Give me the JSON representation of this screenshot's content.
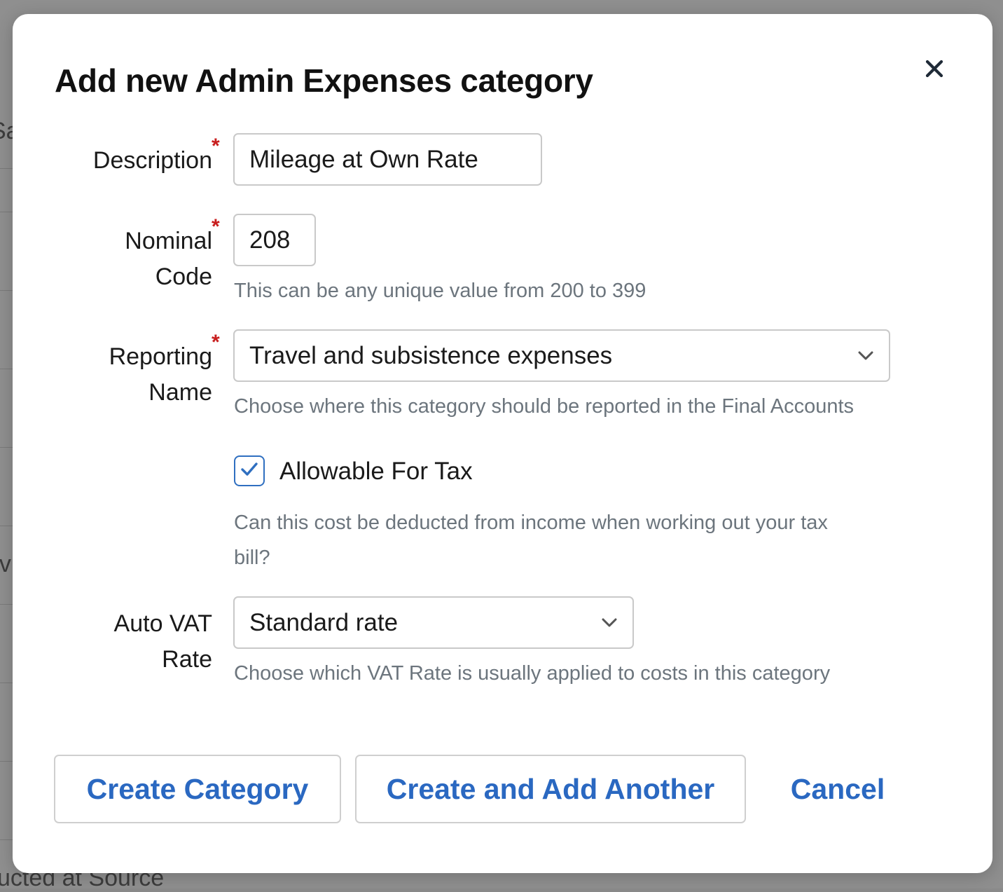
{
  "background": {
    "fragment_top": "Sa",
    "fragment_mid": "ev",
    "fragment_bottom": "ucted at Source"
  },
  "modal": {
    "title": "Add new Admin Expenses category",
    "close_icon": "close-icon"
  },
  "form": {
    "description": {
      "label": "Description",
      "required_mark": "*",
      "value": "Mileage at Own Rate"
    },
    "nominal_code": {
      "label_line1": "Nominal",
      "label_line2": "Code",
      "required_mark": "*",
      "value": "208",
      "help": "This can be any unique value from 200 to 399"
    },
    "reporting_name": {
      "label_line1": "Reporting",
      "label_line2": "Name",
      "required_mark": "*",
      "selected": "Travel and subsistence expenses",
      "help": "Choose where this category should be reported in the Final Accounts"
    },
    "allowable_for_tax": {
      "label": "Allowable For Tax",
      "checked": true,
      "help_line1": "Can this cost be deducted from income when working out your tax",
      "help_line2": "bill?"
    },
    "auto_vat_rate": {
      "label_line1": "Auto VAT",
      "label_line2": "Rate",
      "selected": "Standard rate",
      "help": "Choose which VAT Rate is usually applied to costs in this category"
    }
  },
  "actions": {
    "create": "Create Category",
    "create_another": "Create and Add Another",
    "cancel": "Cancel"
  },
  "colors": {
    "accent": "#2a68c1",
    "required": "#c81e1e",
    "help_text": "#6c757d"
  }
}
